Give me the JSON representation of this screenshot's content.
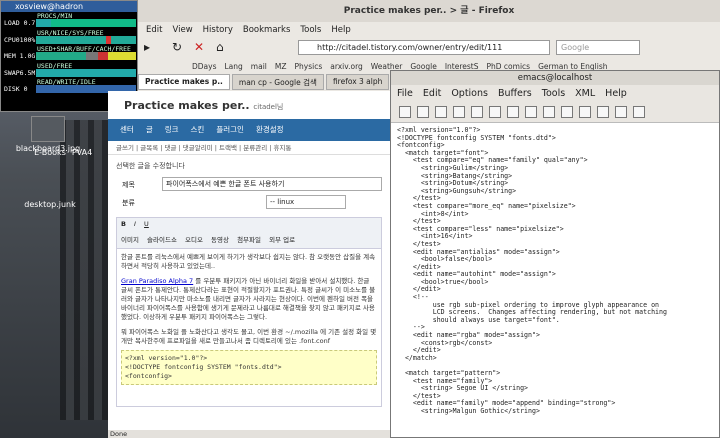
{
  "desktop": {
    "icons": [
      {
        "label": "blackboard3.jpg"
      },
      {
        "label": "E-Books"
      },
      {
        "label": "PVA4"
      },
      {
        "label": "desktop.junk"
      }
    ]
  },
  "xosview": {
    "title": "xosview@hadron",
    "rows": [
      {
        "label": "LOAD 0.7",
        "header": "PROCS/MIN"
      },
      {
        "label": "CPU0100%",
        "header": "USR/NICE/SYS/FREE"
      },
      {
        "label": "MEM 1.0G",
        "header": "USED+SHAR/BUFF/CACH/FREE"
      },
      {
        "label": "SWAP6.5M",
        "header": "USED/FREE"
      },
      {
        "label": "DISK 0",
        "header": "READ/WRITE/IDLE"
      }
    ]
  },
  "firefox": {
    "title": "Practice makes per.. > 글 - Firefox",
    "menu": [
      "Edit",
      "View",
      "History",
      "Bookmarks",
      "Tools",
      "Help"
    ],
    "url": "http://citadel.tistory.com/owner/entry/edit/111",
    "search_placeholder": "Google",
    "bookmarks": [
      "DDays",
      "Lang",
      "mail",
      "MZ",
      "Physics",
      "arxiv.org",
      "Weather",
      "Google",
      "InterestS",
      "PhD comics",
      "German to English"
    ],
    "tabs": [
      {
        "label": "Practice makes p..",
        "active": true
      },
      {
        "label": "man cp - Google 검색",
        "active": false
      },
      {
        "label": "firefox 3 alph",
        "active": false
      }
    ],
    "status": "Done"
  },
  "blog": {
    "title": "Practice makes per..",
    "subtitle": "citadel님",
    "nav": [
      "센터",
      "글",
      "링크",
      "스킨",
      "플러그인",
      "환경설정"
    ],
    "subnav": "글쓰기 | 글목록 | 댓글 | 댓글알리미 | 트랙백 | 분류관리 | 휴지통",
    "notice": "선택한 글을 수정합니다",
    "fields": {
      "title_label": "제목",
      "title_value": "파이어폭스에서 예쁜 한글 폰트 사용하기",
      "category_label": "분류",
      "category_value": "-- linux"
    },
    "tools": [
      "이미지",
      "슬라이드쇼",
      "오디오",
      "동영상",
      "첨부파일",
      "외부 업로"
    ],
    "body_para1": "한글 폰트를 리눅스에서 예쁘게 보이게 하기가 생각보다 쉽지는 않다. 참 오랫동안 삽질을 계속하면서 적당히 사용하고 있었는데..",
    "body_link": "Gran Paradiso Alpha 7",
    "body_para2": "를 우분투 패키지가 아닌 바이너리 화일을 받아서 설치했다. 한글 글씨 폰트가 통제안다. 통제산다라는 표현이 적절할지가 포트권나. 특정 글씨가 이 미소노를 불러와 글자가 나타나지만 마소노를 내리면 글자가 사라지는 현상이다. 이번에 펜하일 버전 폭을 바이너리 파이어폭스를 사용함에 생기게 문제라고 나름대로 해결책을 찾지 않고 패키지로 사용했었다. 이상하게 우분투 패키지 파이어폭스는 그렇다.",
    "body_para3": "뭐 파이어폭스 노화일 플 노화산다고 생각도 몰고, 이번 환경 ~/.mozilla 에 기존 설정 화일 몇개만 복사한주에 프로파일을 새로 만들고나서 좀 디렉토리에 있는 .font.conf",
    "code": [
      "<?xml version=\"1.0\"?>",
      "<!DOCTYPE fontconfig SYSTEM \"fonts.dtd\">",
      "<fontconfig>"
    ]
  },
  "emacs": {
    "title": "emacs@localhost",
    "menu": [
      "File",
      "Edit",
      "Options",
      "Buffers",
      "Tools",
      "XML",
      "Help"
    ],
    "code": "<?xml version=\"1.0\"?>\n<!DOCTYPE fontconfig SYSTEM \"fonts.dtd\">\n<fontconfig>\n  <match target=\"font\">\n    <test compare=\"eq\" name=\"family\" qual=\"any\">\n      <string>Gulim</string>\n      <string>Batang</string>\n      <string>Dotum</string>\n      <string>Gungsuh</string>\n    </test>\n    <test compare=\"more_eq\" name=\"pixelsize\">\n      <int>8</int>\n    </test>\n    <test compare=\"less\" name=\"pixelsize\">\n      <int>16</int>\n    </test>\n    <edit name=\"antialias\" mode=\"assign\">\n      <bool>false</bool>\n    </edit>\n    <edit name=\"autohint\" mode=\"assign\">\n      <bool>true</bool>\n    </edit>\n    <!--\n         use rgb sub-pixel ordering to improve glyph appearance on\n         LCD screens.  Changes affecting rendering, but not matching\n         should always use target=\"font\".\n    -->\n    <edit name=\"rgba\" mode=\"assign\">\n      <const>rgb</const>\n    </edit>\n  </match>\n\n  <match target=\"pattern\">\n    <test name=\"family\">\n      <string> Segoe UI </string>\n    </test>\n    <edit name=\"family\" mode=\"append\" binding=\"strong\">\n      <string>Malgun Gothic</string>"
  }
}
